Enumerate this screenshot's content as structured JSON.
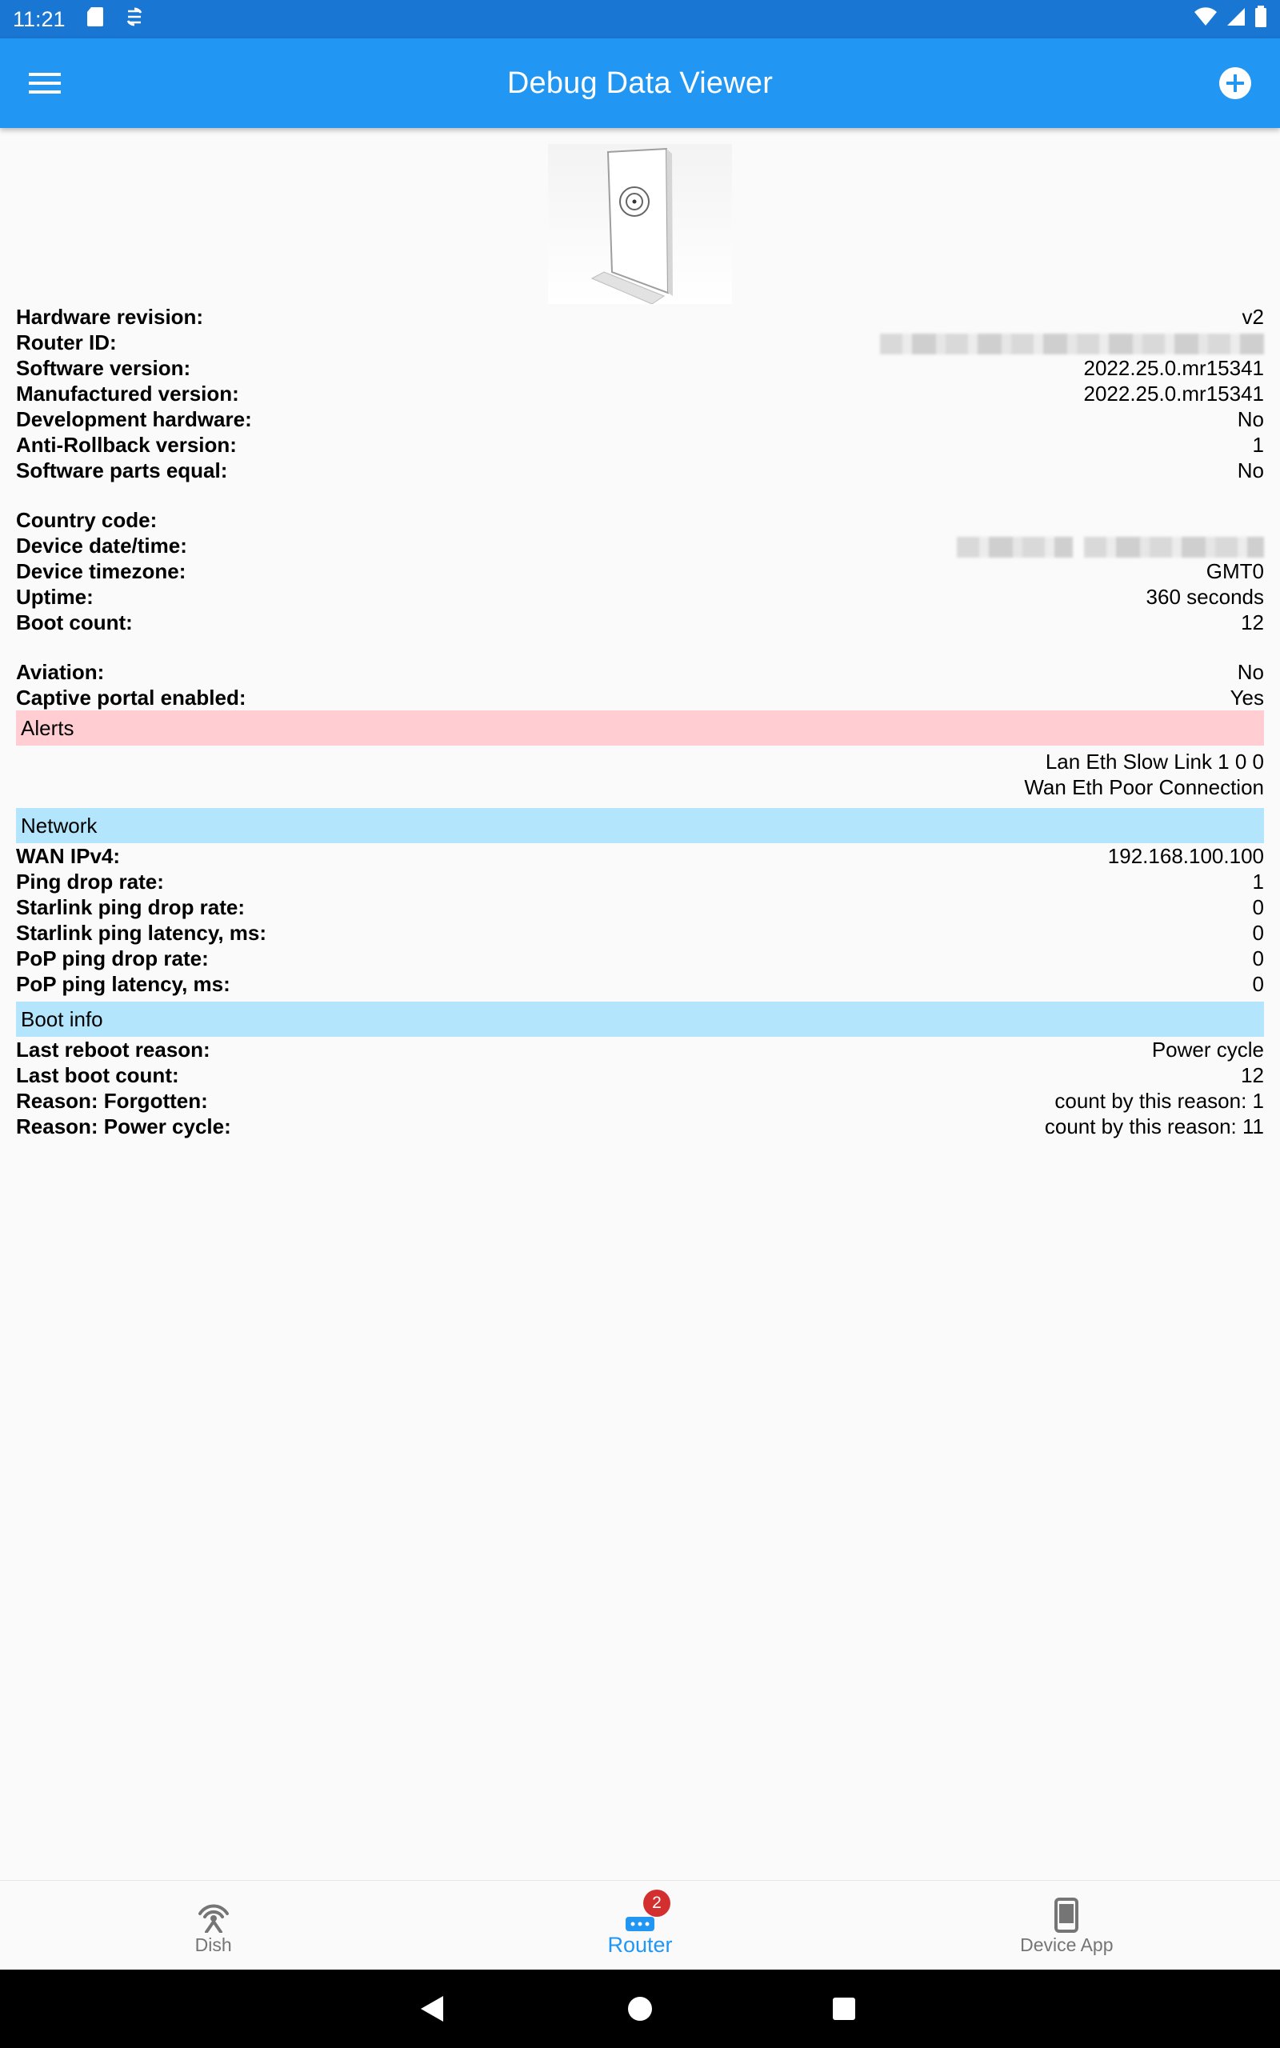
{
  "status_bar": {
    "time": "11:21"
  },
  "app_bar": {
    "title": "Debug Data Viewer"
  },
  "device_info": [
    {
      "label": "Hardware revision:",
      "value": "v2"
    },
    {
      "label": "Router ID:",
      "value": ""
    },
    {
      "label": "Software version:",
      "value": "2022.25.0.mr15341"
    },
    {
      "label": "Manufactured version:",
      "value": "2022.25.0.mr15341"
    },
    {
      "label": "Development hardware:",
      "value": "No"
    },
    {
      "label": "Anti-Rollback version:",
      "value": "1"
    },
    {
      "label": "Software parts equal:",
      "value": "No"
    },
    {
      "label": "Country code:",
      "value": ""
    },
    {
      "label": "Device date/time:",
      "value": ""
    },
    {
      "label": "Device timezone:",
      "value": "GMT0"
    },
    {
      "label": "Uptime:",
      "value": "360 seconds"
    },
    {
      "label": "Boot count:",
      "value": "12"
    },
    {
      "label": "Aviation:",
      "value": "No"
    },
    {
      "label": "Captive portal enabled:",
      "value": "Yes"
    }
  ],
  "alerts": {
    "header": "Alerts",
    "items": [
      "Lan Eth Slow Link 1 0 0",
      "Wan Eth Poor Connection"
    ]
  },
  "network": {
    "header": "Network",
    "rows": [
      {
        "label": "WAN IPv4:",
        "value": "192.168.100.100"
      },
      {
        "label": "Ping drop rate:",
        "value": "1"
      },
      {
        "label": "Starlink ping drop rate:",
        "value": "0"
      },
      {
        "label": "Starlink ping latency, ms:",
        "value": "0"
      },
      {
        "label": "PoP ping drop rate:",
        "value": "0"
      },
      {
        "label": "PoP ping latency, ms:",
        "value": "0"
      }
    ]
  },
  "boot_info": {
    "header": "Boot info",
    "rows": [
      {
        "label": "Last reboot reason:",
        "value": "Power cycle"
      },
      {
        "label": "Last boot count:",
        "value": "12"
      },
      {
        "label": "Reason: Forgotten:",
        "value": "count by this reason: 1"
      },
      {
        "label": "Reason: Power cycle:",
        "value": "count by this reason: 11"
      }
    ]
  },
  "bottom_nav": {
    "items": [
      {
        "label": "Dish",
        "icon": "dish-icon"
      },
      {
        "label": "Router",
        "icon": "router-icon",
        "badge": "2",
        "active": true
      },
      {
        "label": "Device App",
        "icon": "phone-icon"
      }
    ]
  },
  "colors": {
    "app_bar": "#2196f3",
    "status_bar": "#1976d2",
    "alerts_bg": "#ffcdd2",
    "section_bg": "#b3e5fc",
    "badge": "#d32f2f"
  }
}
